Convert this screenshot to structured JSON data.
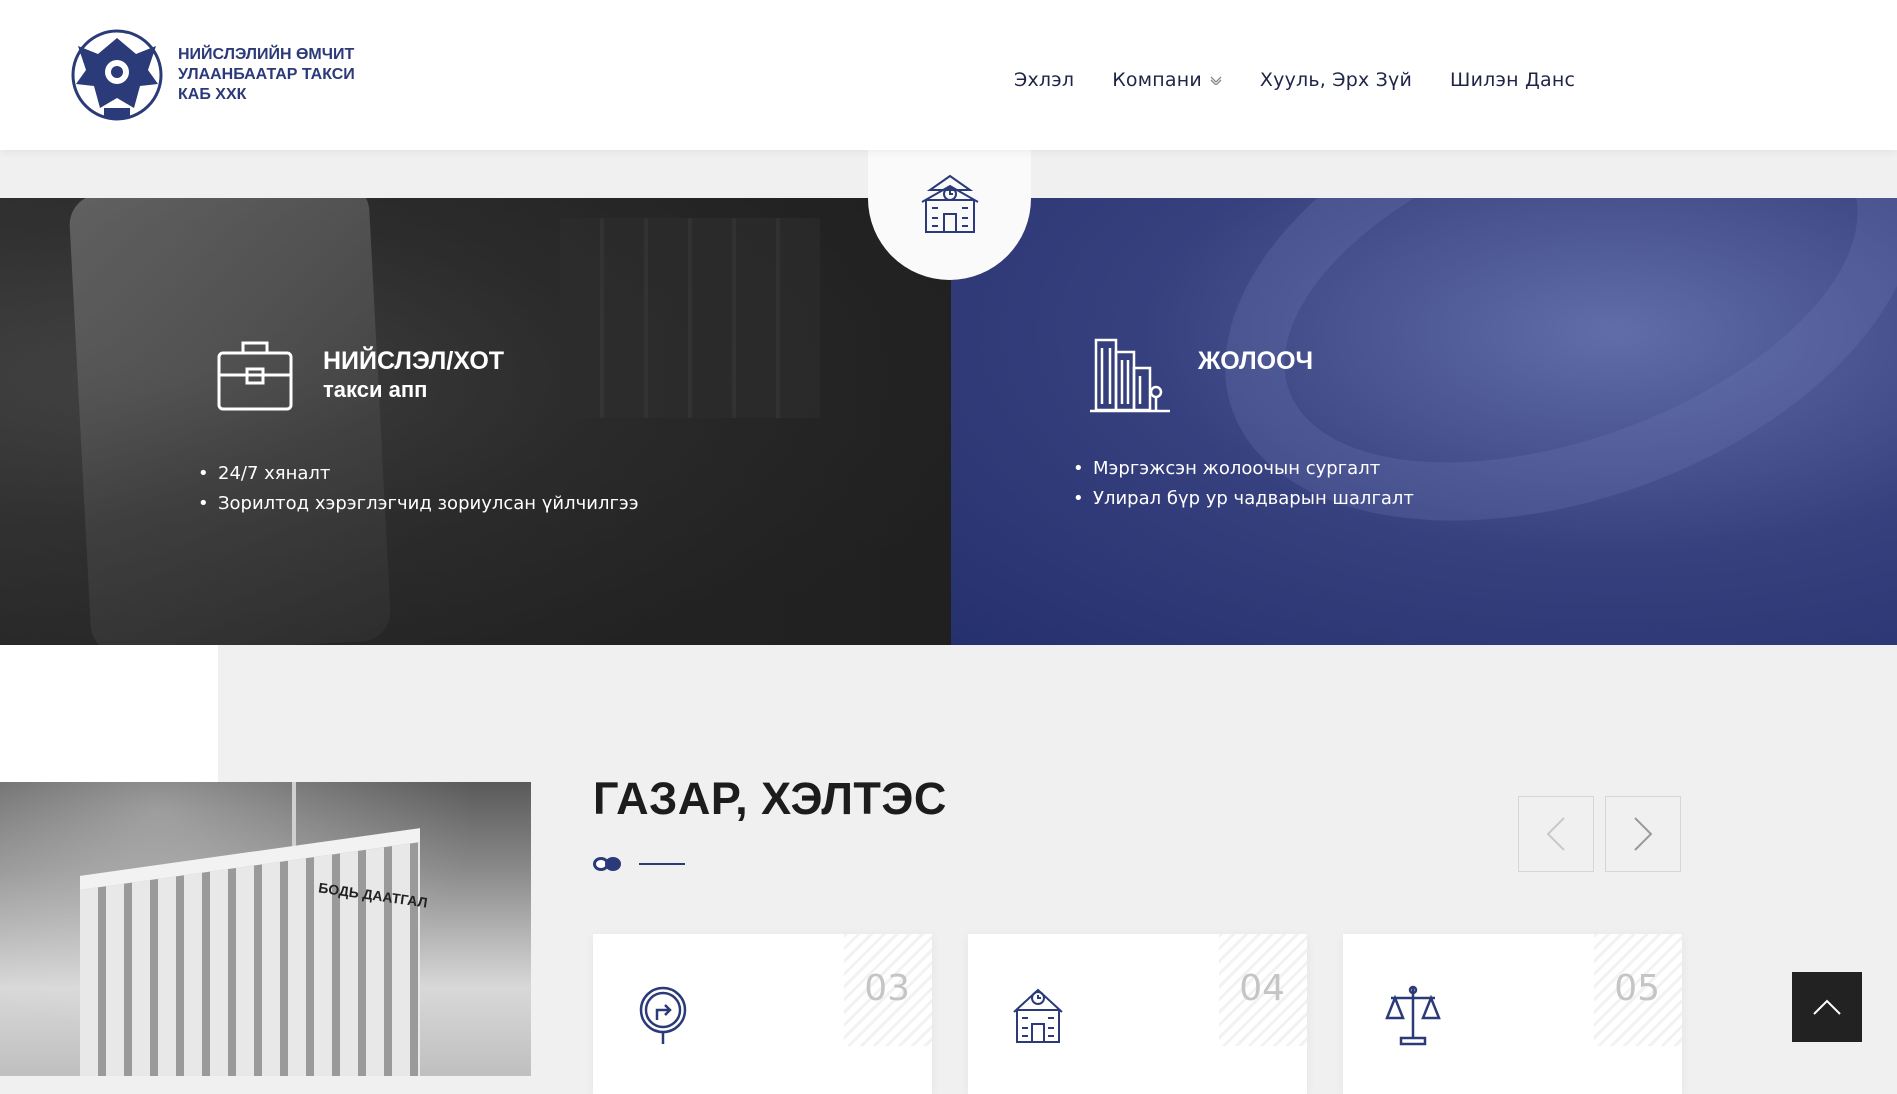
{
  "header": {
    "logo_text": "НИЙСЛЭЛИЙН ӨМЧИТ\nУЛААНБААТАР ТАКСИ\nКАБ ХХК",
    "nav": [
      {
        "label": "Эхлэл"
      },
      {
        "label": "Компани",
        "has_dropdown": true
      },
      {
        "label": "Хууль, Эрх Зүй"
      },
      {
        "label": "Шилэн Данс"
      }
    ]
  },
  "hero": {
    "center_icon": "school-building-icon",
    "left": {
      "icon": "briefcase-icon",
      "title": "НИЙСЛЭЛ/ХОТ",
      "subtitle": "такси апп",
      "items": [
        "24/7 хяналт",
        "Зорилтод хэрэглэгчид зориулсан үйлчилгээ"
      ]
    },
    "right": {
      "icon": "city-buildings-icon",
      "title": "ЖОЛООЧ",
      "items": [
        "Мэргэжсэн жолоочын сургалт",
        "Улирал бүр ур чадварын шалгалт"
      ]
    }
  },
  "places": {
    "building_sign": "БОДЬ ДААТГАЛ",
    "title": "ГАЗАР, ХЭЛТЭС",
    "prev_icon": "chevron-left-icon",
    "next_icon": "chevron-right-icon",
    "cards": [
      {
        "number": "03",
        "icon": "turn-right-sign-icon"
      },
      {
        "number": "04",
        "icon": "school-building-icon"
      },
      {
        "number": "05",
        "icon": "scales-of-justice-icon"
      }
    ]
  },
  "scroll_top_icon": "chevron-up-icon",
  "colors": {
    "brand": "#2b3a78",
    "dark": "#222222",
    "bg": "#f0f0f0"
  }
}
